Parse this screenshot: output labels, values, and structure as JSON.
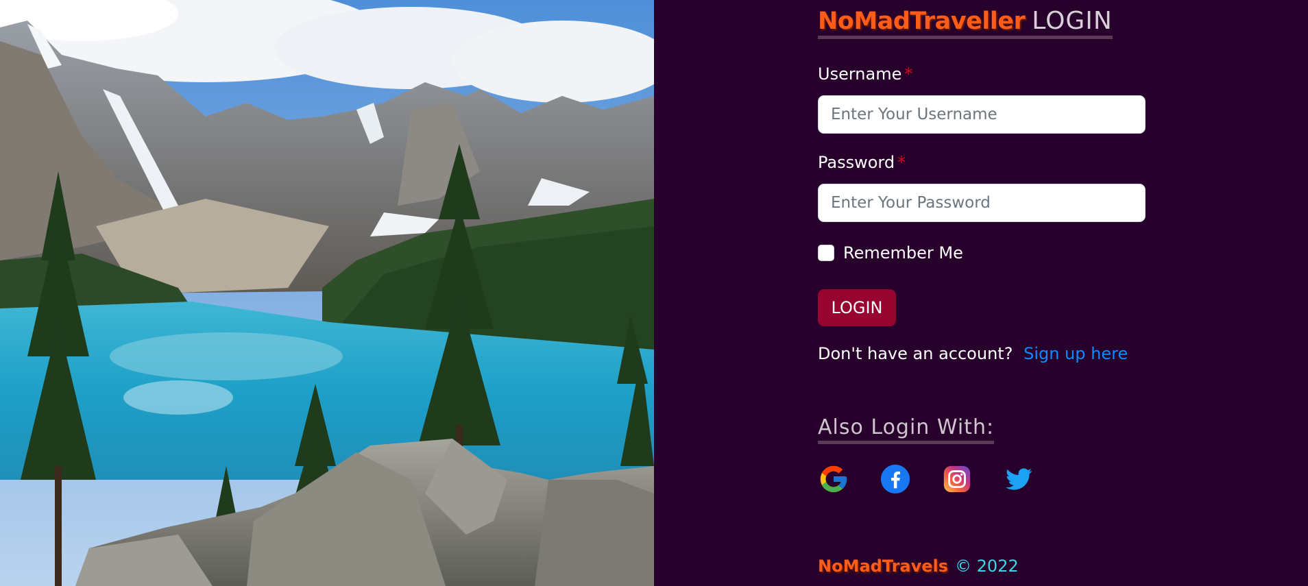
{
  "header": {
    "brand": "NoMadTraveller",
    "title_suffix": "LOGIN"
  },
  "form": {
    "username_label": "Username",
    "username_placeholder": "Enter Your Username",
    "password_label": "Password",
    "password_placeholder": "Enter Your Password",
    "required_marker": "*",
    "remember_label": "Remember Me",
    "remember_checked": false,
    "login_button": "LOGIN"
  },
  "signup": {
    "prompt": "Don't have an account?",
    "link": "Sign up here"
  },
  "social": {
    "heading": "Also Login With:",
    "providers": [
      "google-icon",
      "facebook-icon",
      "instagram-icon",
      "twitter-icon"
    ]
  },
  "footer": {
    "brand": "NoMadTravels",
    "copyright": "© 2022"
  },
  "colors": {
    "background": "#27002b",
    "brand": "#ff5c1a",
    "button": "#97042f",
    "link": "#0d8bff",
    "required": "#e0001b",
    "footer_copy": "#3fd6e6"
  }
}
